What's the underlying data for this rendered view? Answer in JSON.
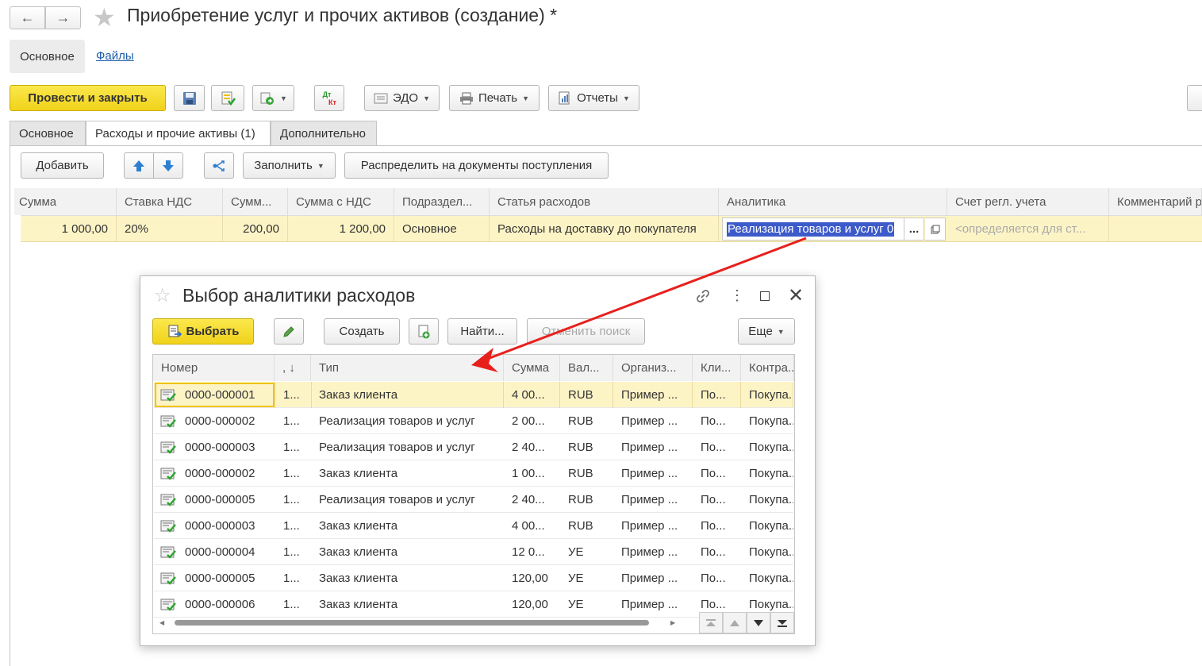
{
  "window": {
    "title": "Приобретение услуг и прочих активов (создание) *"
  },
  "nav_links": {
    "main": "Основное",
    "files": "Файлы"
  },
  "toolbar": {
    "post_close": "Провести и закрыть",
    "edo": "ЭДО",
    "print": "Печать",
    "reports": "Отчеты",
    "dt_kt_top": "Дт",
    "dt_kt_bottom": "Кт"
  },
  "tabs": [
    {
      "label": "Основное"
    },
    {
      "label": "Расходы и прочие активы (1)"
    },
    {
      "label": "Дополнительно"
    }
  ],
  "table_toolbar": {
    "add": "Добавить",
    "fill": "Заполнить",
    "distribute": "Распределить на документы поступления"
  },
  "table": {
    "columns": [
      "Сумма",
      "Ставка НДС",
      "Сумм...",
      "Сумма с НДС",
      "Подраздел...",
      "Статья расходов",
      "Аналитика",
      "Счет регл. учета",
      "Комментарий р"
    ],
    "row": {
      "sum": "1 000,00",
      "vat_rate": "20%",
      "vat_sum": "200,00",
      "sum_with_vat": "1 200,00",
      "department": "Основное",
      "expense_item": "Расходы на доставку до покупателя",
      "analytics": "Реализация товаров и услуг 0",
      "analytics_btn": "...",
      "account": "<определяется для ст..."
    }
  },
  "dialog": {
    "title": "Выбор аналитики расходов",
    "buttons": {
      "select": "Выбрать",
      "create": "Создать",
      "find": "Найти...",
      "cancel_search": "Отменить поиск",
      "more": "Еще"
    },
    "columns": [
      "Номер",
      ", ↓",
      "Тип",
      "Сумма",
      "Вал...",
      "Организ...",
      "Кли...",
      "Контра..."
    ],
    "rows": [
      {
        "number": "0000-000001",
        "date": "1...",
        "type": "Заказ клиента",
        "sum": "4 00...",
        "currency": "RUB",
        "org": "Пример ...",
        "client": "По...",
        "contract": "Покупа..."
      },
      {
        "number": "0000-000002",
        "date": "1...",
        "type": "Реализация товаров и услуг",
        "sum": "2 00...",
        "currency": "RUB",
        "org": "Пример ...",
        "client": "По...",
        "contract": "Покупа..."
      },
      {
        "number": "0000-000003",
        "date": "1...",
        "type": "Реализация товаров и услуг",
        "sum": "2 40...",
        "currency": "RUB",
        "org": "Пример ...",
        "client": "По...",
        "contract": "Покупа..."
      },
      {
        "number": "0000-000002",
        "date": "1...",
        "type": "Заказ клиента",
        "sum": "1 00...",
        "currency": "RUB",
        "org": "Пример ...",
        "client": "По...",
        "contract": "Покупа..."
      },
      {
        "number": "0000-000005",
        "date": "1...",
        "type": "Реализация товаров и услуг",
        "sum": "2 40...",
        "currency": "RUB",
        "org": "Пример ...",
        "client": "По...",
        "contract": "Покупа..."
      },
      {
        "number": "0000-000003",
        "date": "1...",
        "type": "Заказ клиента",
        "sum": "4 00...",
        "currency": "RUB",
        "org": "Пример ...",
        "client": "По...",
        "contract": "Покупа..."
      },
      {
        "number": "0000-000004",
        "date": "1...",
        "type": "Заказ клиента",
        "sum": "12 0...",
        "currency": "УЕ",
        "org": "Пример ...",
        "client": "По...",
        "contract": "Покупа..."
      },
      {
        "number": "0000-000005",
        "date": "1...",
        "type": "Заказ клиента",
        "sum": "120,00",
        "currency": "УЕ",
        "org": "Пример ...",
        "client": "По...",
        "contract": "Покупа..."
      },
      {
        "number": "0000-000006",
        "date": "1...",
        "type": "Заказ клиента",
        "sum": "120,00",
        "currency": "УЕ",
        "org": "Пример ...",
        "client": "По...",
        "contract": "Покупа..."
      }
    ]
  },
  "colors": {
    "accent_yellow": "#f5dc2a",
    "row_highlight": "#fdf4c6",
    "selection_blue": "#3c5ac9",
    "arrow_red": "#e8201c"
  }
}
